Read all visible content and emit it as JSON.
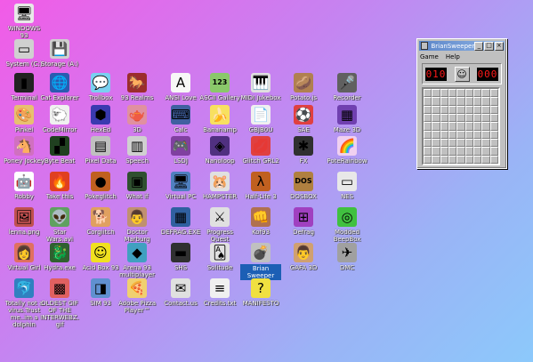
{
  "desktop": {
    "icons": [
      {
        "label": "WINDOWS 93",
        "glyph": "🖥",
        "bg": "#e8e8e8",
        "icon": "computer-icon"
      },
      {
        "label": "System (C:)",
        "glyph": "▭",
        "bg": "#d0d0d0",
        "icon": "drive-icon"
      },
      {
        "label": "Storage (A:)",
        "glyph": "💾",
        "bg": "#d0d0d0",
        "icon": "floppy-icon"
      },
      {
        "label": "Terminal",
        "glyph": "▮",
        "bg": "#222",
        "icon": "terminal-icon"
      },
      {
        "label": "Cat Explorer",
        "glyph": "🌐",
        "bg": "#2a5bb0",
        "icon": "globe-icon"
      },
      {
        "label": "Trollbox",
        "glyph": "💬",
        "bg": "#7ad0f0",
        "icon": "chat-icon"
      },
      {
        "label": "93 Realms",
        "glyph": "🐎",
        "bg": "#9b2d2d",
        "icon": "horse-icon"
      },
      {
        "label": "ANSI Love",
        "glyph": "A",
        "bg": "#f7f7f7",
        "icon": "ansi-icon"
      },
      {
        "label": "ASCII Gallery",
        "glyph": "123",
        "bg": "#8ac86a",
        "icon": "ascii-icon"
      },
      {
        "label": "MIDI Jukebox",
        "glyph": "🎹",
        "bg": "#e0e0e0",
        "icon": "piano-icon"
      },
      {
        "label": "Potato.js",
        "glyph": "🥔",
        "bg": "#b08050",
        "icon": "potato-icon"
      },
      {
        "label": "Recorder",
        "glyph": "🎤",
        "bg": "#606060",
        "icon": "microphone-icon"
      },
      {
        "label": "Pinkel",
        "glyph": "🎨",
        "bg": "#e8c070",
        "icon": "palette-icon"
      },
      {
        "label": "CodeMirror",
        "glyph": "🐑",
        "bg": "#f0f0f0",
        "icon": "sheep-icon"
      },
      {
        "label": "HexEd",
        "glyph": "⬢",
        "bg": "#3a3ab0",
        "icon": "cube-icon"
      },
      {
        "label": "3D",
        "glyph": "🫖",
        "bg": "#e090a0",
        "icon": "teapot-icon"
      },
      {
        "label": "Calc",
        "glyph": "⌨",
        "bg": "#4060a0",
        "icon": "calculator-icon"
      },
      {
        "label": "Bananamp",
        "glyph": "🍌",
        "bg": "#f8e060",
        "icon": "banana-icon"
      },
      {
        "label": "GBJB0U",
        "glyph": "📄",
        "bg": "#f0f0f0",
        "icon": "document-icon"
      },
      {
        "label": "SAE",
        "glyph": "⚽",
        "bg": "#e04040",
        "icon": "ball-icon"
      },
      {
        "label": "Maze 3D",
        "glyph": "▦",
        "bg": "#7040b0",
        "icon": "maze-icon"
      },
      {
        "label": "Poney Jockey",
        "glyph": "🐴",
        "bg": "#d070c0",
        "icon": "pony-icon"
      },
      {
        "label": "Byte Beat",
        "glyph": "▞",
        "bg": "#204020",
        "icon": "bytebeat-icon"
      },
      {
        "label": "Pixel Data",
        "glyph": "▤",
        "bg": "#c0c0c0",
        "icon": "pixel-icon"
      },
      {
        "label": "Speech",
        "glyph": "▥",
        "bg": "#d0d0d0",
        "icon": "speech-icon"
      },
      {
        "label": "LSDJ",
        "glyph": "🎮",
        "bg": "#8040a0",
        "icon": "gameboy-icon"
      },
      {
        "label": "Nanoloop",
        "glyph": "◈",
        "bg": "#503080",
        "icon": "nanoloop-icon"
      },
      {
        "label": "Glitch GRL2",
        "glyph": "💋",
        "bg": "#e04040",
        "icon": "lips-icon"
      },
      {
        "label": "FX",
        "glyph": "✱",
        "bg": "#303030",
        "icon": "fx-icon"
      },
      {
        "label": "PoteRainbow",
        "glyph": "🌈",
        "bg": "#f0d0f0",
        "icon": "rainbow-icon"
      },
      {
        "label": "Robby",
        "glyph": "🤖",
        "bg": "#ffffff",
        "icon": "robot-icon"
      },
      {
        "label": "Take this",
        "glyph": "🔥",
        "bg": "#e04020",
        "icon": "fire-icon"
      },
      {
        "label": "Pokeglitch",
        "glyph": "●",
        "bg": "#c06020",
        "icon": "poke-icon"
      },
      {
        "label": "What if",
        "glyph": "▣",
        "bg": "#305030",
        "icon": "whatif-icon"
      },
      {
        "label": "Virtual PC",
        "glyph": "🖥",
        "bg": "#5080c0",
        "icon": "pc-icon"
      },
      {
        "label": "HAMPSTER",
        "glyph": "🐹",
        "bg": "#e0e0e0",
        "icon": "hamster-icon"
      },
      {
        "label": "Half-Life 3",
        "glyph": "λ",
        "bg": "#c06020",
        "icon": "halflife-icon"
      },
      {
        "label": "DOSBOX",
        "glyph": "DOS",
        "bg": "#b08040",
        "icon": "dosbox-icon"
      },
      {
        "label": "NES",
        "glyph": "▭",
        "bg": "#e8e8e8",
        "icon": "nes-icon"
      },
      {
        "label": "lenna.png",
        "glyph": "🖼",
        "bg": "#c05050",
        "icon": "image-icon"
      },
      {
        "label": "Star Wars.avi",
        "glyph": "👽",
        "bg": "#60a060",
        "icon": "yoda-icon"
      },
      {
        "label": "Corgiitch",
        "glyph": "🐕",
        "bg": "#e0a060",
        "icon": "corgi-icon"
      },
      {
        "label": "Doctor Marburg",
        "glyph": "👨",
        "bg": "#c09070",
        "icon": "doctor-icon"
      },
      {
        "label": "DEFRAG.EXE",
        "glyph": "▦",
        "bg": "#3060a0",
        "icon": "defrag-icon"
      },
      {
        "label": "Progress Quest",
        "glyph": "⚔",
        "bg": "#e0e0e0",
        "icon": "quest-icon"
      },
      {
        "label": "Kof93",
        "glyph": "👊",
        "bg": "#b07050",
        "icon": "fighter-icon"
      },
      {
        "label": "Defrag",
        "glyph": "⊞",
        "bg": "#a040c0",
        "icon": "defrag2-icon"
      },
      {
        "label": "Modded BeepBox",
        "glyph": "◎",
        "bg": "#40c040",
        "icon": "beepbox-icon"
      },
      {
        "label": "Virtual Girl",
        "glyph": "👩",
        "bg": "#e07060",
        "icon": "girl-icon"
      },
      {
        "label": "Hydra.exe",
        "glyph": "🐉",
        "bg": "#306030",
        "icon": "hydra-icon"
      },
      {
        "label": "Acid Box 93",
        "glyph": "☺",
        "bg": "#f0e020",
        "icon": "acid-icon"
      },
      {
        "label": "Arena 93 multiplayer",
        "glyph": "◆",
        "bg": "#40a0c0",
        "icon": "arena-icon"
      },
      {
        "label": "SHS",
        "glyph": "▬",
        "bg": "#303030",
        "icon": "shs-icon"
      },
      {
        "label": "Solitude",
        "glyph": "🂡",
        "bg": "#e0e0e0",
        "icon": "cards-icon"
      },
      {
        "label": "Brian Sweeper",
        "glyph": "💣",
        "bg": "#c0c0c0",
        "icon": "mine-icon",
        "selected": true
      },
      {
        "label": "GAFA 3D",
        "glyph": "👨",
        "bg": "#d0a070",
        "icon": "face-icon"
      },
      {
        "label": "DMC",
        "glyph": "✈",
        "bg": "#a0a0a0",
        "icon": "dmc-icon"
      },
      {
        "label": "Totally not a virus.Trust me..im a dolphin",
        "glyph": "🐬",
        "bg": "#3080c0",
        "icon": "dolphin-icon"
      },
      {
        "label": "OLDEST GIF OF THE INTERWEBZ.gif",
        "glyph": "▩",
        "bg": "#e06060",
        "icon": "gif-icon"
      },
      {
        "label": "SIM 93",
        "glyph": "◨",
        "bg": "#6090d0",
        "icon": "sim-icon"
      },
      {
        "label": "Adobe Pizza Player™",
        "glyph": "🍕",
        "bg": "#f0d070",
        "icon": "pizza-icon"
      },
      {
        "label": "Contact.us",
        "glyph": "✉",
        "bg": "#e0e0e0",
        "icon": "contact-icon"
      },
      {
        "label": "Credits.txt",
        "glyph": "≡",
        "bg": "#f0f0f0",
        "icon": "text-icon"
      },
      {
        "label": "MANIFESTO",
        "glyph": "?",
        "bg": "#f0e040",
        "icon": "question-icon"
      }
    ]
  },
  "window": {
    "title": "BrianSweeper",
    "menu": [
      "Game",
      "Help"
    ],
    "mines_left": "010",
    "smiley": "☺",
    "timer": "000",
    "rows": 9,
    "cols": 9,
    "minimize": "_",
    "maximize": "□",
    "close": "×"
  }
}
